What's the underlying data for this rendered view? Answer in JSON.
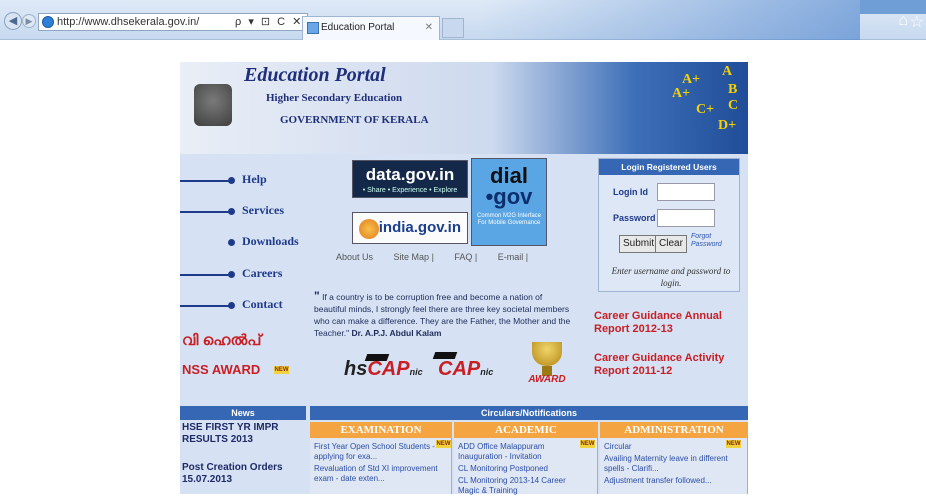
{
  "browser": {
    "url": "http://www.dhsekerala.gov.in/",
    "url_controls": "ρ ▾ ⊡ C ✕",
    "tab_title": "Education Portal",
    "tab_close": "✕"
  },
  "header": {
    "portal_title": "Education Portal",
    "subtitle": "Higher Secondary Education",
    "government": "GOVERNMENT OF KERALA",
    "grades": [
      "A+",
      "A",
      "B",
      "A+",
      "C",
      "C+",
      "D+"
    ]
  },
  "nav": {
    "items": [
      "Help",
      "Services",
      "Downloads",
      "Careers",
      "Contact"
    ]
  },
  "logos": {
    "datagov_main": "data.gov.in",
    "datagov_tag": "• Share • Experience • Explore",
    "indiagov": "india.gov.in",
    "dialgov_top": "dial",
    "dialgov_bottom": "•gov",
    "dialgov_tag": "Common M2G Interface For Mobile Governance"
  },
  "quick_links": [
    "About Us",
    "Site Map |",
    "FAQ |",
    "E-mail |"
  ],
  "quote": {
    "text": "If a country is to be corruption free and become a nation of beautiful minds, I strongly feel there are three key societal members who can make a difference. They are the Father, the Mother and the Teacher.\"",
    "author": "Dr. A.P.J. Abdul Kalam"
  },
  "login": {
    "heading": "Login Registered Users",
    "login_id_label": "Login Id",
    "password_label": "Password",
    "submit": "Submit",
    "clear": "Clear",
    "forgot": "Forgot Password",
    "note": "Enter username and password to login."
  },
  "career": {
    "annual_report": "Career Guidance Annual Report 2012-13",
    "activity_report": "Career Guidance Activity Report 2011-12"
  },
  "left_promo": {
    "malayalam": "വി ഹെൽപ്",
    "nss_award": "NSS AWARD",
    "new_badge": "NEW"
  },
  "cap_logos": {
    "hscap_hs": "hs",
    "hscap_cap": "CAP",
    "hscap_nic": "nic",
    "cap_cap": "CAP",
    "cap_nic": "nic",
    "award": "AWARD"
  },
  "news": {
    "heading": "News",
    "items": [
      "HSE FIRST YR IMPR RESULTS 2013",
      "Post Creation Orders 15.07.2013"
    ]
  },
  "circulars": {
    "heading": "Circulars/Notifications",
    "columns": [
      {
        "title": "EXAMINATION",
        "items": [
          "First Year Open School Students - applying for exa...",
          "Revaluation of Std XI improvement exam - date exten..."
        ]
      },
      {
        "title": "ACADEMIC",
        "items": [
          "ADD Office Malappuram Inauguration - Invitation",
          "CL Monitoring Postponed",
          "CL Monitoring 2013-14 Career Magic & Training"
        ]
      },
      {
        "title": "ADMINISTRATION",
        "items": [
          "Circular",
          "Availing Maternity leave in different spells - Clarifi...",
          "Adjustment transfer followed..."
        ]
      }
    ],
    "new_badge": "NEW"
  }
}
